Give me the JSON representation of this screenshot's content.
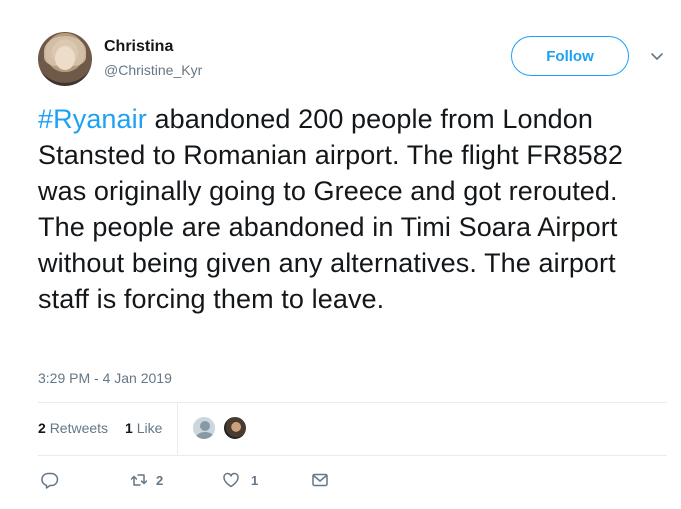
{
  "author": {
    "name": "Christina",
    "handle": "@Christine_Kyr"
  },
  "follow_label": "Follow",
  "tweet": {
    "hashtag": "#Ryanair",
    "text": " abandoned 200 people from London Stansted to Romanian airport. The flight FR8582 was originally going to Greece and got rerouted. The people are abandoned in Timi Soara Airport without being given any alternatives. The airport staff is forcing them to leave."
  },
  "timestamp": "3:29 PM - 4 Jan 2019",
  "stats": {
    "retweets_count": "2",
    "retweets_label": "Retweets",
    "likes_count": "1",
    "likes_label": "Like"
  },
  "actions": {
    "retweet_count": "2",
    "like_count": "1"
  },
  "icons": [
    "reply-icon",
    "retweet-icon",
    "heart-icon",
    "envelope-icon",
    "chevron-down-icon"
  ],
  "colors": {
    "accent": "#1da1f2",
    "muted": "#657786",
    "text": "#14171a"
  }
}
